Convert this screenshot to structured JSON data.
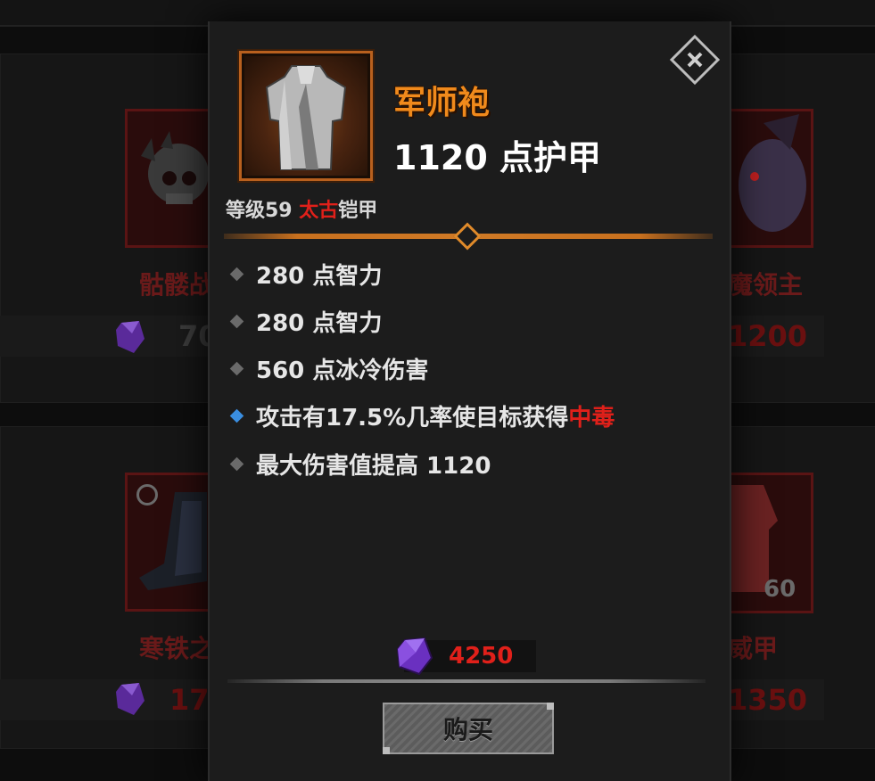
{
  "background": {
    "cards": [
      {
        "name": "骷髅战",
        "price": "70"
      },
      {
        "name": "魔领主",
        "price": "1200"
      },
      {
        "name": "寒铁之",
        "price": "17"
      },
      {
        "name": "威甲",
        "price": "1350",
        "level": "60"
      }
    ]
  },
  "item": {
    "name": "军师袍",
    "armor": "1120 点护甲",
    "level_prefix": "等级59 ",
    "rarity": "太古",
    "type": "铠甲",
    "stats": [
      {
        "text": "280 点智力",
        "bullet": "grey"
      },
      {
        "text": "280 点智力",
        "bullet": "grey"
      },
      {
        "text": "560 点冰冷伤害",
        "bullet": "grey"
      },
      {
        "text": "攻击有17.5%几率使目标获得",
        "highlight": "中毒",
        "bullet": "blue"
      },
      {
        "text": "最大伤害值提高 1120",
        "bullet": "grey"
      }
    ],
    "price": "4250",
    "currency_icon": "purple-gem-icon",
    "buy_label": "购买",
    "close_icon": "close-icon"
  },
  "colors": {
    "item_name": "#f08a1c",
    "rarity": "#e0201a",
    "price": "#e0201a",
    "divider": "#c8701e",
    "bullet_special": "#3a8ee0"
  }
}
